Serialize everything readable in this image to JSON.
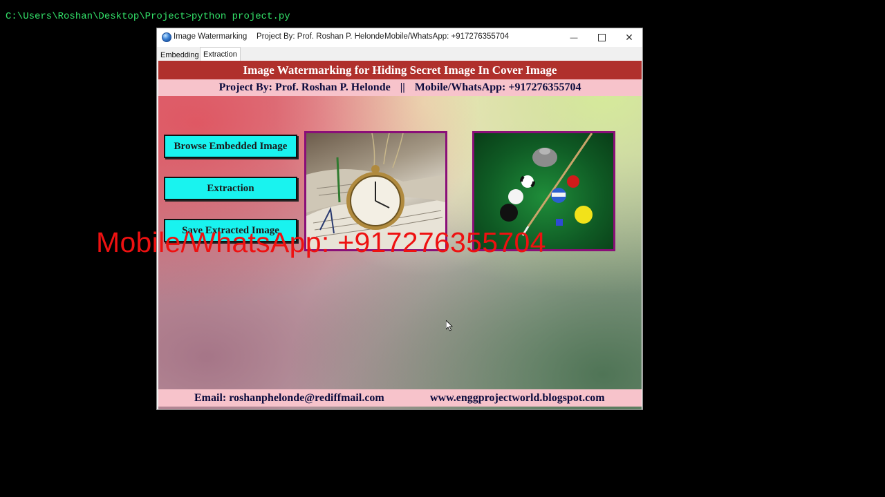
{
  "console": {
    "command_line": "C:\\Users\\Roshan\\Desktop\\Project>python project.py"
  },
  "window": {
    "title": "Image Watermarking",
    "project_by": "Project By: Prof. Roshan P. Helonde",
    "mobile": "Mobile/WhatsApp: +917276355704",
    "controls": {
      "minimize": "—",
      "close": "✕"
    }
  },
  "tabs": [
    {
      "label": "Embedding",
      "selected": false
    },
    {
      "label": "Extraction",
      "selected": true
    }
  ],
  "header": {
    "title": "Image Watermarking for Hiding Secret Image In Cover Image",
    "project_by": "Project By: Prof. Roshan P. Helonde",
    "separator": "||",
    "mobile": "Mobile/WhatsApp: +917276355704"
  },
  "buttons": {
    "browse": "Browse Embedded Image",
    "extraction": "Extraction",
    "save": "Save Extracted Image"
  },
  "images": {
    "embedded_icon": "pocket-watch-on-book-image",
    "extracted_icon": "billiard-balls-image",
    "frame_color": "#8a0f78"
  },
  "footer": {
    "email": "Email: roshanphelonde@rediffmail.com",
    "website": "www.enggprojectworld.blogspot.com"
  },
  "overlay": {
    "text": "Mobile/WhatsApp: +917276355704",
    "color": "#ee1111"
  },
  "colors": {
    "banner": "#b0302c",
    "subbanner": "#f7c3cb",
    "button": "#19f3ef",
    "console_text": "#33e36a"
  }
}
